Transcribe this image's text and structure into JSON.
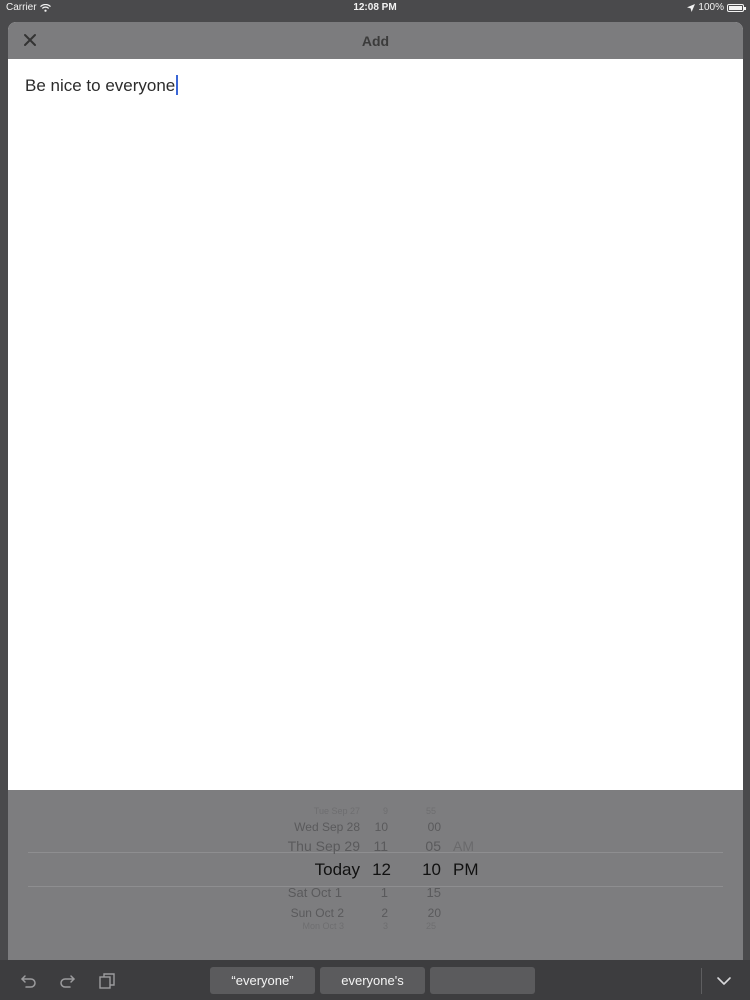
{
  "status_bar": {
    "carrier": "Carrier",
    "time": "12:08 PM",
    "battery": "100%"
  },
  "nav": {
    "title": "Add",
    "close_icon": "close-icon"
  },
  "editor": {
    "text": "Be nice to everyone"
  },
  "picker": {
    "dates": [
      "Tue Sep 27",
      "Wed Sep 28",
      "Thu Sep 29",
      "Today",
      "Sat Oct 1",
      "Sun Oct 2",
      "Mon Oct 3"
    ],
    "hours": [
      "9",
      "10",
      "11",
      "12",
      "1",
      "2",
      "3"
    ],
    "minutes": [
      "55",
      "00",
      "05",
      "10",
      "15",
      "20",
      "25"
    ],
    "ampm": [
      "AM",
      "PM"
    ],
    "selected": {
      "date": "Today",
      "hour": "12",
      "minute": "10",
      "ampm": "PM"
    }
  },
  "keyboard_bar": {
    "suggestions": [
      "“everyone”",
      "everyone's",
      ""
    ],
    "icons": [
      "undo-icon",
      "redo-icon",
      "paste-icon",
      "dismiss-keyboard-icon"
    ]
  }
}
